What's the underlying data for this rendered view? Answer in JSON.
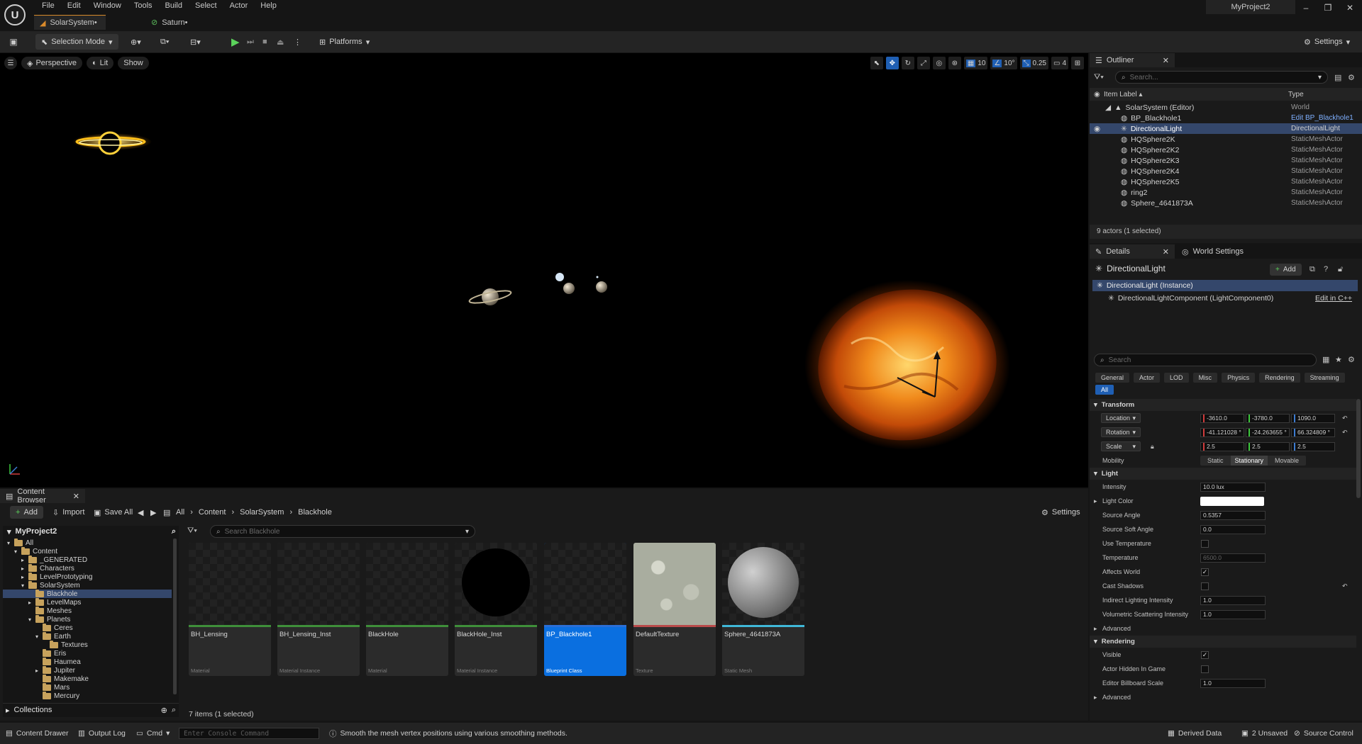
{
  "menu": [
    "File",
    "Edit",
    "Window",
    "Tools",
    "Build",
    "Select",
    "Actor",
    "Help"
  ],
  "window": {
    "project": "MyProject2",
    "min": "–",
    "max": "❐",
    "close": "✕"
  },
  "doc_tabs": [
    "SolarSystem•",
    "Saturn•"
  ],
  "toolbar": {
    "selection_mode": "Selection Mode",
    "platforms": "Platforms",
    "settings": "Settings"
  },
  "viewport": {
    "perspective": "Perspective",
    "lit": "Lit",
    "show": "Show",
    "grid_snap": "10",
    "rot_snap": "10°",
    "scale_snap": "0.25",
    "cam_speed": "4"
  },
  "outliner": {
    "tab": "Outliner",
    "search_placeholder": "Search...",
    "col_label": "Item Label ▴",
    "col_type": "Type",
    "rows": [
      {
        "label": "SolarSystem (Editor)",
        "type": "World"
      },
      {
        "label": "BP_Blackhole1",
        "type": "Edit BP_Blackhole1"
      },
      {
        "label": "DirectionalLight",
        "type": "DirectionalLight"
      },
      {
        "label": "HQSphere2K",
        "type": "StaticMeshActor"
      },
      {
        "label": "HQSphere2K2",
        "type": "StaticMeshActor"
      },
      {
        "label": "HQSphere2K3",
        "type": "StaticMeshActor"
      },
      {
        "label": "HQSphere2K4",
        "type": "StaticMeshActor"
      },
      {
        "label": "HQSphere2K5",
        "type": "StaticMeshActor"
      },
      {
        "label": "ring2",
        "type": "StaticMeshActor"
      },
      {
        "label": "Sphere_4641873A",
        "type": "StaticMeshActor"
      }
    ],
    "footer": "9 actors (1 selected)"
  },
  "details": {
    "tab": "Details",
    "world_settings_tab": "World Settings",
    "actor_name": "DirectionalLight",
    "add": "Add",
    "instance": "DirectionalLight (Instance)",
    "component": "DirectionalLightComponent (LightComponent0)",
    "edit_cpp": "Edit in C++",
    "search_placeholder": "Search",
    "categories": [
      "General",
      "Actor",
      "LOD",
      "Misc",
      "Physics",
      "Rendering",
      "Streaming",
      "All"
    ],
    "transform": {
      "title": "Transform",
      "location_label": "Location",
      "rotation_label": "Rotation",
      "scale_label": "Scale",
      "location": [
        "-3610.0",
        "-3780.0",
        "1090.0"
      ],
      "rotation": [
        "-41.121028 °",
        "-24.263655 °",
        "66.324809 °"
      ],
      "scale": [
        "2.5",
        "2.5",
        "2.5"
      ],
      "mobility_label": "Mobility",
      "mobility_options": [
        "Static",
        "Stationary",
        "Movable"
      ]
    },
    "light": {
      "title": "Light",
      "intensity_label": "Intensity",
      "intensity": "10.0 lux",
      "color_label": "Light Color",
      "color": "#ffffff",
      "source_angle_label": "Source Angle",
      "source_angle": "0.5357",
      "soft_angle_label": "Source Soft Angle",
      "soft_angle": "0.0",
      "use_temp_label": "Use Temperature",
      "temp_label": "Temperature",
      "temp": "6500.0",
      "affects_world_label": "Affects World",
      "cast_shadows_label": "Cast Shadows",
      "indirect_label": "Indirect Lighting Intensity",
      "indirect": "1.0",
      "volumetric_label": "Volumetric Scattering Intensity",
      "volumetric": "1.0",
      "advanced": "Advanced"
    },
    "rendering": {
      "title": "Rendering",
      "visible_label": "Visible",
      "hidden_label": "Actor Hidden In Game",
      "billboard_label": "Editor Billboard Scale",
      "billboard": "1.0",
      "advanced": "Advanced"
    }
  },
  "content_browser": {
    "tab": "Content Browser",
    "add": "Add",
    "import": "Import",
    "save_all": "Save All",
    "breadcrumb": [
      "All",
      "Content",
      "SolarSystem",
      "Blackhole"
    ],
    "settings": "Settings",
    "project": "MyProject2",
    "search_placeholder": "Search Blackhole",
    "tree": [
      {
        "label": "All",
        "depth": 0
      },
      {
        "label": "Content",
        "depth": 1
      },
      {
        "label": "_GENERATED",
        "depth": 2
      },
      {
        "label": "Characters",
        "depth": 2
      },
      {
        "label": "LevelPrototyping",
        "depth": 2
      },
      {
        "label": "SolarSystem",
        "depth": 2
      },
      {
        "label": "Blackhole",
        "depth": 3
      },
      {
        "label": "LevelMaps",
        "depth": 3
      },
      {
        "label": "Meshes",
        "depth": 3
      },
      {
        "label": "Planets",
        "depth": 3
      },
      {
        "label": "Ceres",
        "depth": 4
      },
      {
        "label": "Earth",
        "depth": 4
      },
      {
        "label": "Textures",
        "depth": 5
      },
      {
        "label": "Eris",
        "depth": 4
      },
      {
        "label": "Haumea",
        "depth": 4
      },
      {
        "label": "Jupiter",
        "depth": 4
      },
      {
        "label": "Makemake",
        "depth": 4
      },
      {
        "label": "Mars",
        "depth": 4
      },
      {
        "label": "Mercury",
        "depth": 4
      }
    ],
    "collections": "Collections",
    "assets": [
      {
        "name": "BH_Lensing",
        "type": "Material",
        "bar": "#3f8f3a"
      },
      {
        "name": "BH_Lensing_Inst",
        "type": "Material Instance",
        "bar": "#3f8f3a"
      },
      {
        "name": "BlackHole",
        "type": "Material",
        "bar": "#3f8f3a"
      },
      {
        "name": "BlackHole_Inst",
        "type": "Material Instance",
        "bar": "#3f8f3a"
      },
      {
        "name": "BP_Blackhole1",
        "type": "Blueprint Class",
        "bar": "#2b6fd6"
      },
      {
        "name": "DefaultTexture",
        "type": "Texture",
        "bar": "#b94a4a"
      },
      {
        "name": "Sphere_4641873A",
        "type": "Static Mesh",
        "bar": "#40b8d8"
      }
    ],
    "item_count": "7 items (1 selected)"
  },
  "statusbar": {
    "content_drawer": "Content Drawer",
    "output_log": "Output Log",
    "cmd": "Cmd",
    "console_placeholder": "Enter Console Command",
    "hint": "Smooth the mesh vertex positions using various smoothing methods.",
    "derived_data": "Derived Data",
    "unsaved": "2 Unsaved",
    "source_control": "Source Control"
  }
}
